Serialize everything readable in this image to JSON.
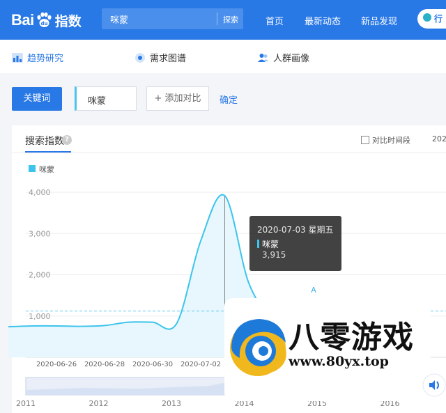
{
  "header": {
    "logo_text": "Bai",
    "logo_suffix": "指数",
    "search_value": "咪蒙",
    "search_button": "探索",
    "nav": [
      "首页",
      "最新动态",
      "新品发现"
    ],
    "pill_label": "行"
  },
  "subnav": {
    "items": [
      {
        "label": "趋势研究",
        "icon": "bar-chart-icon"
      },
      {
        "label": "需求图谱",
        "icon": "radio-icon"
      },
      {
        "label": "人群画像",
        "icon": "users-icon"
      }
    ]
  },
  "controls": {
    "keyword_button": "关键词",
    "keyword_value": "咪蒙",
    "add_compare": "+ 添加对比",
    "confirm": "确定"
  },
  "card": {
    "tab_title": "搜索指数",
    "help": "?",
    "compare_period": "对比时间段",
    "date_cut": "202"
  },
  "chart_data": {
    "type": "area",
    "legend": [
      {
        "name": "咪蒙",
        "color": "#3cc4ec"
      }
    ],
    "ylim": [
      0,
      4000
    ],
    "y_ticks": [
      "4,000",
      "3,000",
      "2,000",
      "1,000"
    ],
    "x_ticks": [
      "2020-06-26",
      "2020-06-28",
      "2020-06-30",
      "2020-07-02",
      "2020-0"
    ],
    "series": [
      {
        "name": "咪蒙",
        "x": [
          "2020-06-24",
          "2020-06-25",
          "2020-06-26",
          "2020-06-27",
          "2020-06-28",
          "2020-06-29",
          "2020-06-30",
          "2020-07-01",
          "2020-07-02",
          "2020-07-03",
          "2020-07-04",
          "2020-07-05",
          "2020-07-06",
          "2020-07-07",
          "2020-07-08",
          "2020-07-09"
        ],
        "values": [
          740,
          760,
          760,
          750,
          770,
          850,
          850,
          820,
          2820,
          3915,
          1800,
          950,
          820,
          770,
          760,
          750
        ]
      }
    ],
    "average_line": 1120,
    "tooltip": {
      "date": "2020-07-03 星期五",
      "name": "咪蒙",
      "value": "3,915"
    },
    "annotation_letter": "A",
    "timeline_years": [
      "2011",
      "2012",
      "2013",
      "2014",
      "2015",
      "2016"
    ]
  },
  "watermark": {
    "title": "八零游戏",
    "url": "www.80yx.top"
  }
}
